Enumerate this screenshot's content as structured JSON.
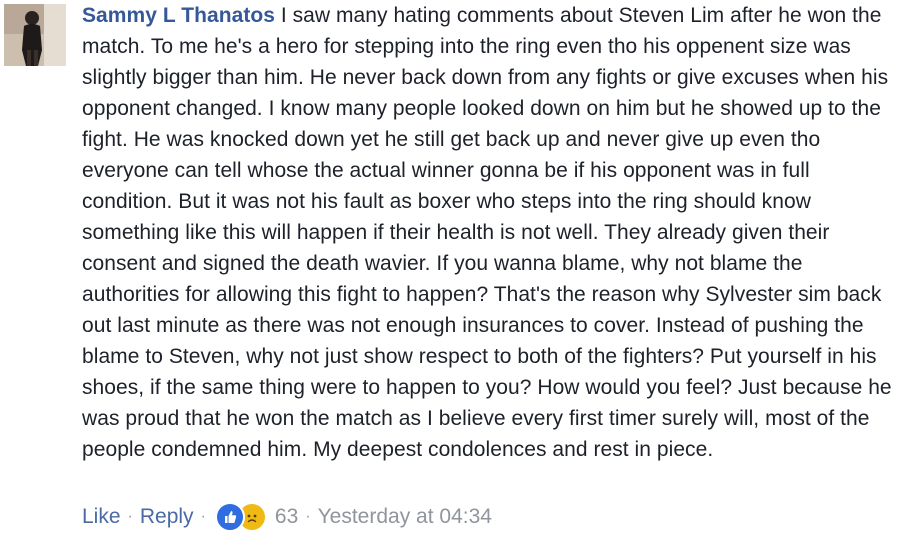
{
  "comment": {
    "author": "Sammy L Thanatos",
    "text": "I saw many hating comments about Steven Lim after he won the match. To me he's a hero for stepping into the ring even tho his oppenent size was slightly bigger than him. He never back down from any fights or give excuses when his opponent changed. I know many people looked down on him but he showed up to the fight. He was knocked down yet he still get back up and never give up even tho everyone can tell whose the actual winner gonna be if his opponent was in full condition. But it was not his fault as boxer who steps into the ring should know something like this will happen if their health is not well. They already given their consent and signed the death wavier. If you wanna blame, why not blame the authorities for allowing this fight to happen? That's the reason why Sylvester sim back out last minute as there was not enough insurances to cover. Instead of pushing the blame to Steven, why not just show respect to both of the fighters? Put yourself in his shoes, if the same thing were to happen to you? How would you feel? Just because he was proud that he won the match as I believe every first timer surely will, most of the people condemned him. My deepest condolences and rest in piece."
  },
  "footer": {
    "like_label": "Like",
    "separator": "·",
    "reply_label": "Reply",
    "reaction_count": "63",
    "timestamp": "Yesterday at 04:34"
  },
  "reactions": {
    "icons": [
      "like-icon",
      "sad-icon"
    ],
    "colors": {
      "like": "#2f6de1",
      "sad": "#f0ba15",
      "author_link": "#365899",
      "meta": "#90949c"
    }
  }
}
